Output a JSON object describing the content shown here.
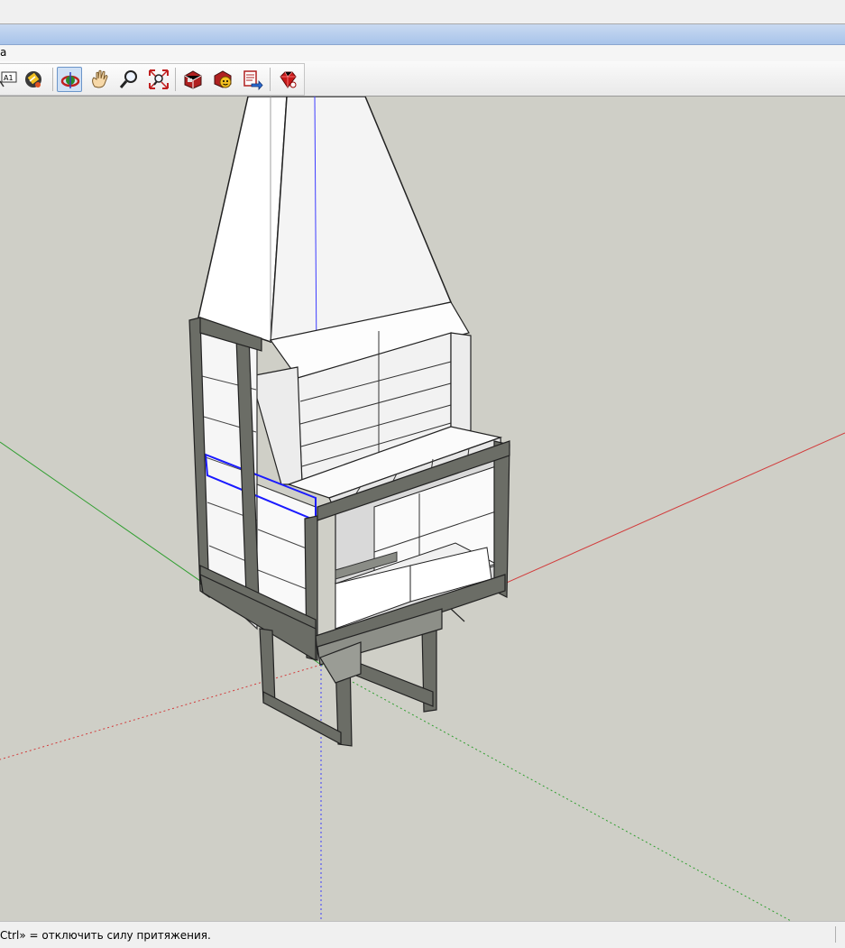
{
  "menubar": {
    "fragment": "a"
  },
  "toolbar": {
    "tools": [
      {
        "name": "text-tool",
        "label": "A1"
      },
      {
        "name": "paint-bucket-tool"
      },
      {
        "name": "orbit-tool",
        "active": true
      },
      {
        "name": "pan-tool"
      },
      {
        "name": "zoom-tool"
      },
      {
        "name": "zoom-extents-tool"
      },
      {
        "name": "get-models-tool"
      },
      {
        "name": "share-component-tool"
      },
      {
        "name": "export-tool"
      },
      {
        "name": "ruby-extension-tool"
      }
    ]
  },
  "statusbar": {
    "hint": "Ctrl» = отключить силу притяжения."
  },
  "colors": {
    "viewport": "#cfcfc7",
    "axis_red": "#d23c3c",
    "axis_green": "#2f9e2f",
    "axis_blue": "#3c3cff",
    "selection": "#1a1aff",
    "steel": "#6b6d66"
  }
}
